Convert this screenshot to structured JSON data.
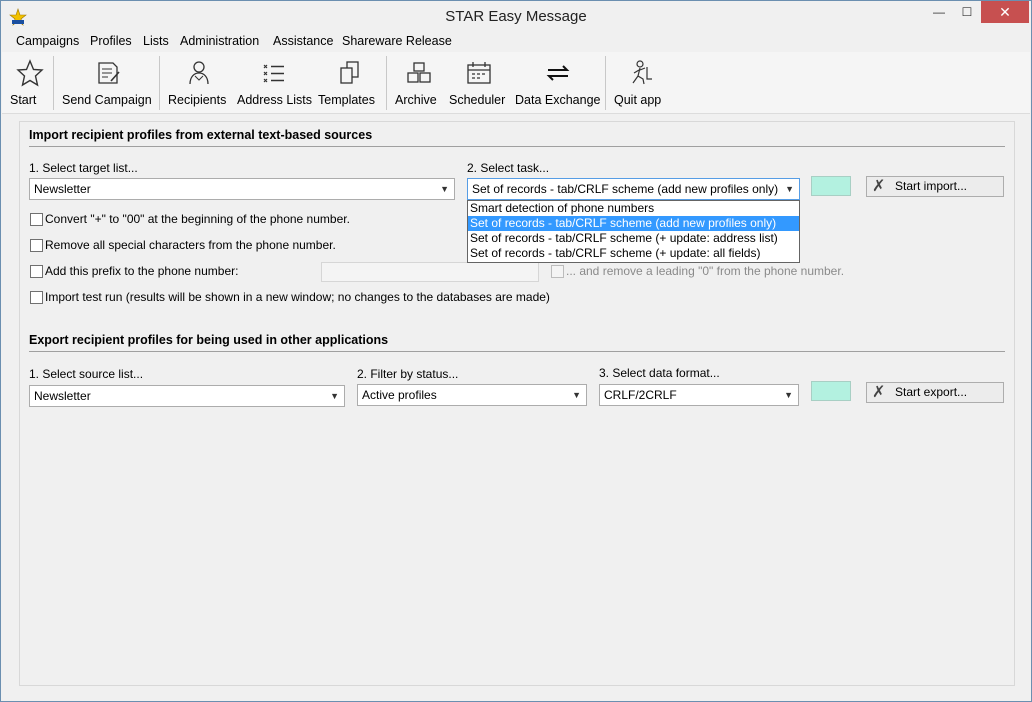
{
  "window": {
    "title": "STAR Easy Message",
    "minimize": "—",
    "maximize": "☐",
    "close": "✕"
  },
  "menu": [
    "Campaigns",
    "Profiles",
    "Lists",
    "Administration",
    "Assistance",
    "Shareware Release"
  ],
  "toolbar": {
    "start": "Start",
    "send_campaign": "Send Campaign",
    "recipients": "Recipients",
    "address_lists": "Address Lists",
    "templates": "Templates",
    "archive": "Archive",
    "scheduler": "Scheduler",
    "data_exchange": "Data Exchange",
    "quit_app": "Quit app"
  },
  "import": {
    "title": "Import recipient profiles from external text-based sources",
    "target_label": "1. Select target list...",
    "target_value": "Newsletter",
    "task_label": "2. Select task...",
    "task_value": "Set of records - tab/CRLF scheme (add new profiles only)",
    "task_options": [
      "Smart detection of phone numbers",
      "Set of records - tab/CRLF scheme (add new profiles only)",
      "Set of records - tab/CRLF scheme (+ update: address list)",
      "Set of records - tab/CRLF scheme (+ update: all fields)"
    ],
    "task_selected_index": 1,
    "start_button": "Start import...",
    "swatch_color": "#b3f1e0",
    "opt_convert": "Convert \"+\" to \"00\" at the beginning of the phone number.",
    "opt_remove": "Remove all special characters from the phone number.",
    "opt_prefix": "Add this prefix to the phone number:",
    "opt_leading_zero": "... and remove a leading \"0\" from the phone number.",
    "opt_test_run": "Import test run (results will be shown in a new window; no changes to the databases are made)"
  },
  "export": {
    "title": "Export recipient profiles for being used in other applications",
    "source_label": "1. Select source list...",
    "source_value": "Newsletter",
    "status_label": "2. Filter by status...",
    "status_value": "Active profiles",
    "format_label": "3. Select data format...",
    "format_value": "CRLF/2CRLF",
    "start_button": "Start export...",
    "swatch_color": "#b3f1e0"
  }
}
